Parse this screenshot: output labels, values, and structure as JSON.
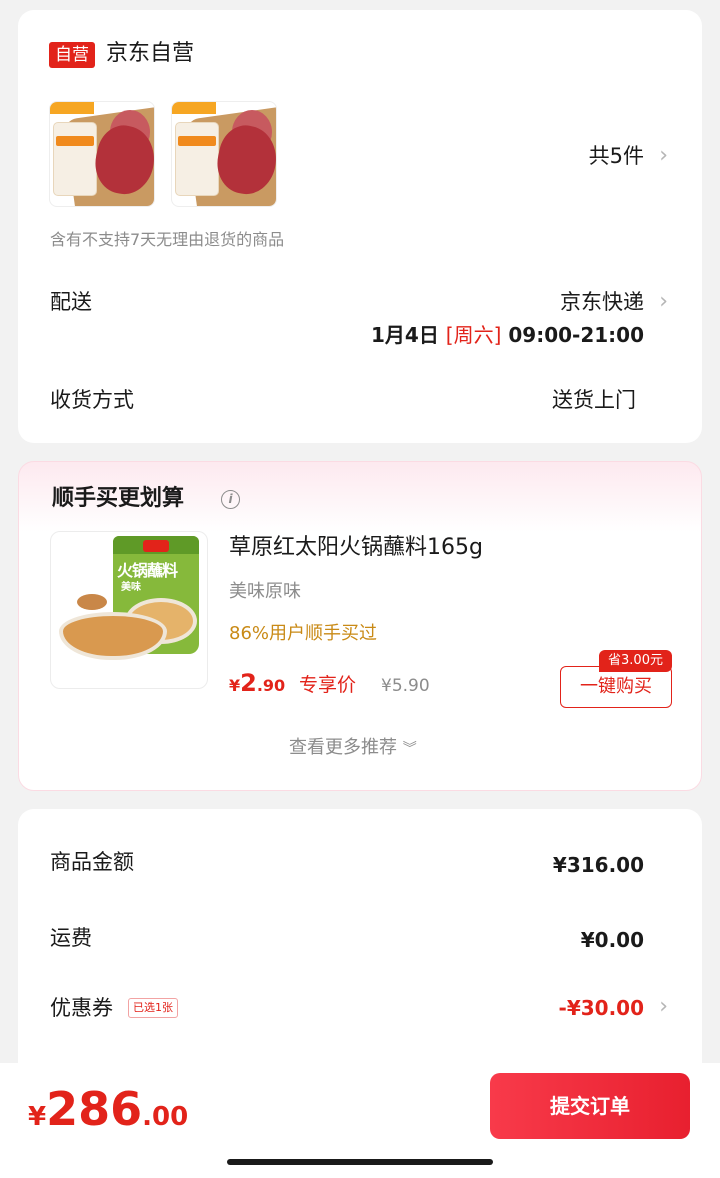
{
  "store": {
    "badge": "自营",
    "name": "京东自营"
  },
  "items": {
    "count_label": "共5件",
    "note": "含有不支持7天无理由退货的商品"
  },
  "delivery": {
    "label": "配送",
    "carrier": "京东快递",
    "date": "1月4日",
    "weekday": "[周六]",
    "time": "09:00-21:00"
  },
  "receive": {
    "label": "收货方式",
    "value": "送货上门"
  },
  "recommend": {
    "title": "顺手买更划算",
    "product_name": "草原红太阳火锅蘸料165g",
    "spec": "美味原味",
    "hot_text": "86%用户顺手买过",
    "price_currency": "¥",
    "price_int": "2",
    "price_dec": ".90",
    "price_tag": "专享价",
    "old_price": "¥5.90",
    "save_badge": "省3.00元",
    "buy_button": "一键购买",
    "more_label": "查看更多推荐",
    "bag_text": "火锅蘸料",
    "bag_sub": "美味"
  },
  "summary": {
    "goods_label": "商品金额",
    "goods_value": "¥316.00",
    "shipping_label": "运费",
    "shipping_value": "¥0.00",
    "coupon_label": "优惠券",
    "coupon_tag": "已选1张",
    "coupon_value": "-¥30.00"
  },
  "footer": {
    "total_currency": "¥",
    "total_int": "286",
    "total_dec": ".00",
    "submit_label": "提交订单"
  },
  "colors": {
    "accent": "#e2231a",
    "hot": "#c98a16",
    "muted": "#8c8c8c"
  }
}
